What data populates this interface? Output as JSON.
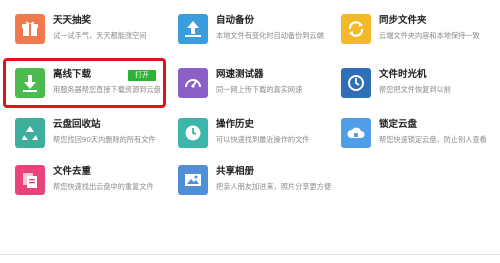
{
  "cards": [
    {
      "title": "天天抽奖",
      "desc": "试一试手气，天天都能涨空间",
      "color": "#f07a4d",
      "icon": "gift-icon"
    },
    {
      "title": "自动备份",
      "desc": "本地文件有变化时自动备份到云端",
      "color": "#3a9dde",
      "icon": "upload-cloud-icon"
    },
    {
      "title": "同步文件夹",
      "desc": "云端文件夹内容和本地保持一致",
      "color": "#f4b92b",
      "icon": "sync-icon"
    },
    {
      "title": "离线下载",
      "desc": "用服务器帮您直接下载资源到云盘",
      "color": "#4cba50",
      "icon": "download-icon"
    },
    {
      "title": "网速测试器",
      "desc": "同一网上传下载的真实网速",
      "color": "#8a60c6",
      "icon": "speedometer-icon"
    },
    {
      "title": "文件时光机",
      "desc": "帮您把文件恢复到以前",
      "color": "#2e6fb8",
      "icon": "time-machine-icon"
    },
    {
      "title": "云盘回收站",
      "desc": "帮您找回90天内删除的所有文件",
      "color": "#3fae9c",
      "icon": "recycle-icon"
    },
    {
      "title": "操作历史",
      "desc": "可以快速找到最近操作的文件",
      "color": "#3cb6a8",
      "icon": "clock-icon"
    },
    {
      "title": "锁定云盘",
      "desc": "帮您快速锁定云盘，防止别人查看",
      "color": "#4f9ee8",
      "icon": "cloud-lock-icon"
    },
    {
      "title": "文件去重",
      "desc": "帮您快速找出云盘中的重复文件",
      "color": "#e8437a",
      "icon": "duplicate-files-icon"
    },
    {
      "title": "共享相册",
      "desc": "把亲人朋友加进来，照片分享更方便",
      "color": "#4f8fd7",
      "icon": "photo-album-icon"
    }
  ],
  "offline_download": {
    "open_label": "打开"
  },
  "colors": {
    "highlight": "#e5101a",
    "open_button": "#2bb336"
  }
}
